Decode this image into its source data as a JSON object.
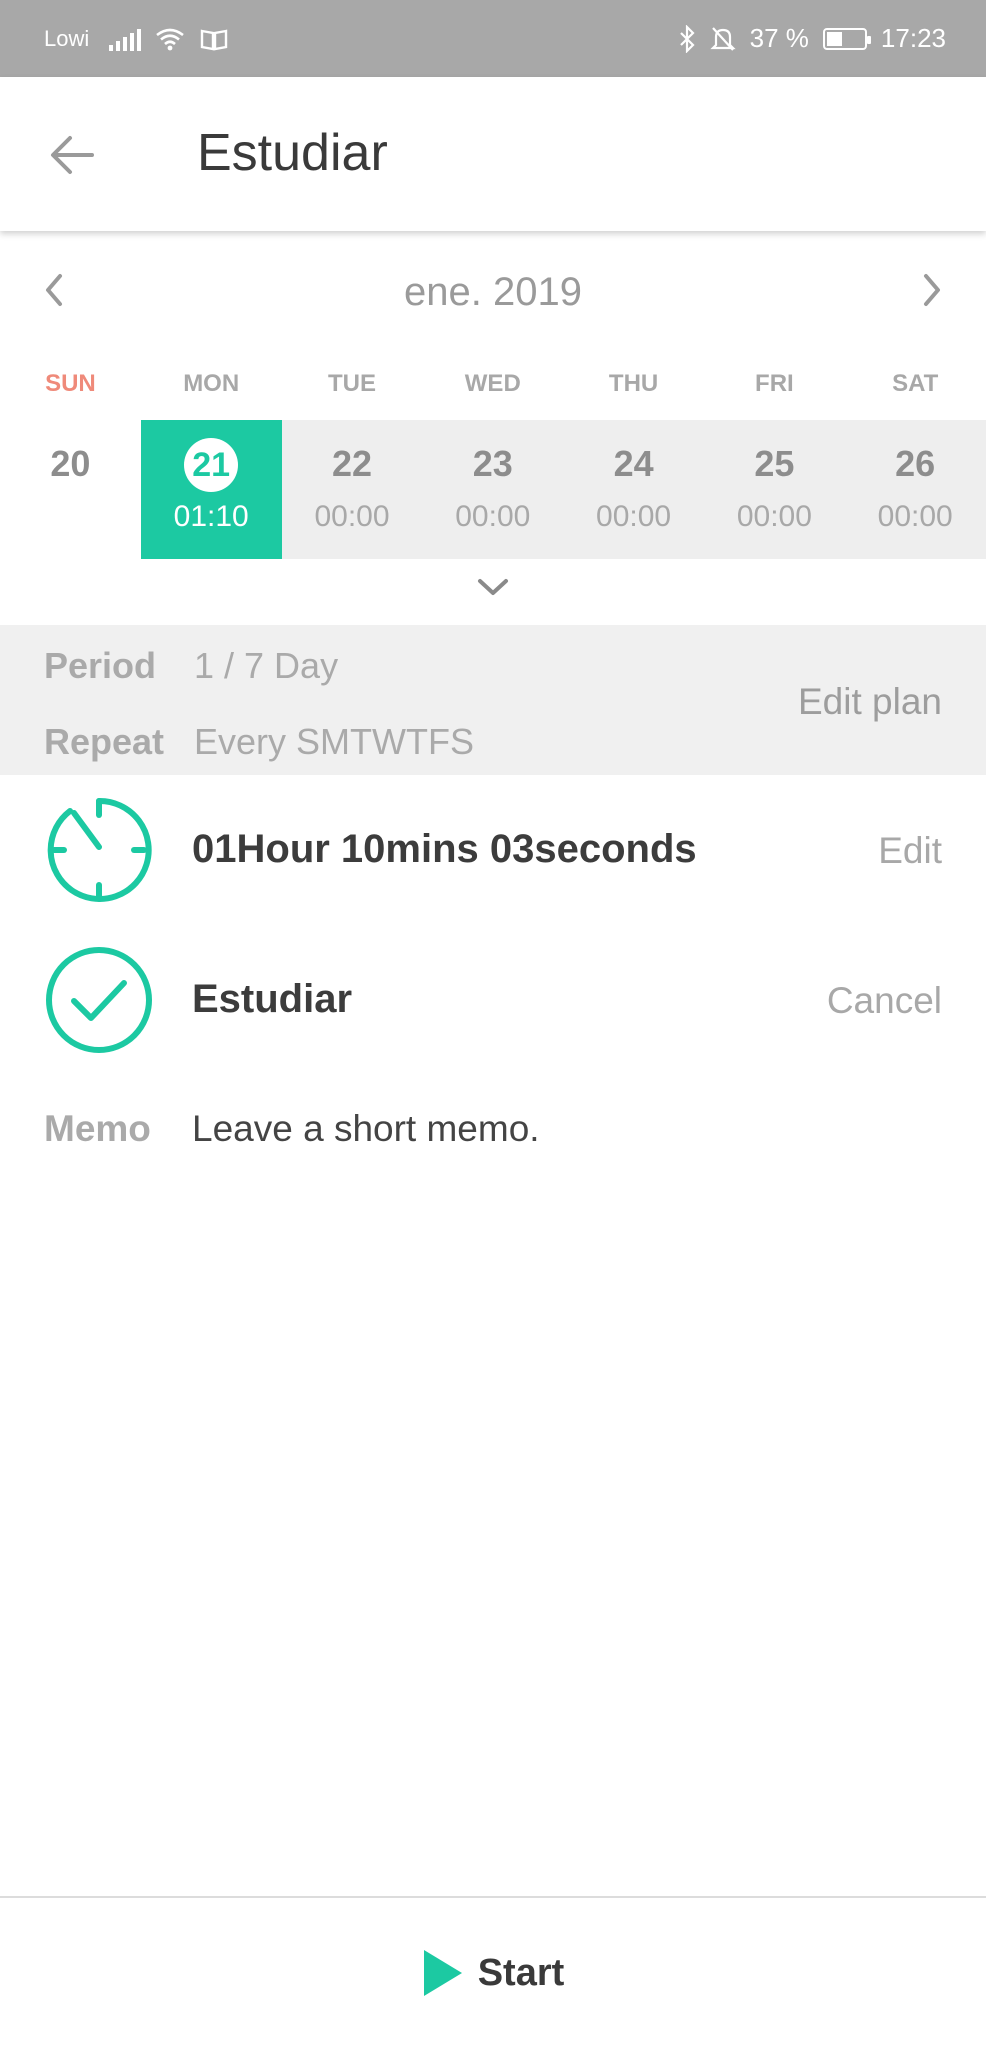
{
  "status_bar": {
    "carrier": "Lowi",
    "battery_percent": "37 %",
    "battery_level": 0.37,
    "time": "17:23",
    "icons": [
      "signal-icon",
      "wifi-icon",
      "book-icon",
      "bluetooth-icon",
      "bell-off-icon",
      "battery-icon"
    ]
  },
  "header": {
    "title": "Estudiar",
    "back_icon": "arrow-left-icon"
  },
  "calendar": {
    "month_label": "ene. 2019",
    "day_names": [
      "SUN",
      "MON",
      "TUE",
      "WED",
      "THU",
      "FRI",
      "SAT"
    ],
    "days": [
      {
        "date": "20",
        "time": ""
      },
      {
        "date": "21",
        "time": "01:10"
      },
      {
        "date": "22",
        "time": "00:00"
      },
      {
        "date": "23",
        "time": "00:00"
      },
      {
        "date": "24",
        "time": "00:00"
      },
      {
        "date": "25",
        "time": "00:00"
      },
      {
        "date": "26",
        "time": "00:00"
      }
    ],
    "selected_day": "21"
  },
  "plan": {
    "period_label": "Period",
    "period_value": "1 / 7 Day",
    "repeat_label": "Repeat",
    "repeat_value": "Every SMTWTFS",
    "edit_label": "Edit plan"
  },
  "timer": {
    "duration": "01Hour 10mins 03seconds",
    "edit_label": "Edit"
  },
  "task": {
    "name": "Estudiar",
    "cancel_label": "Cancel"
  },
  "memo": {
    "label": "Memo",
    "placeholder": "Leave a short memo."
  },
  "footer": {
    "start_label": "Start"
  },
  "colors": {
    "accent": "#1cc9a2",
    "sunday": "#ef8a7a",
    "status_bar": "#a8a8a8",
    "plan_bg": "#f0f0f0"
  }
}
